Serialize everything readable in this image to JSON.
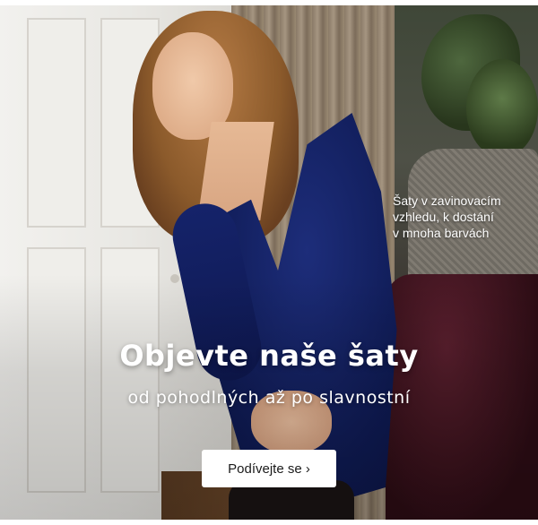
{
  "banner": {
    "caption_lines": [
      "Šaty v zavinovacím",
      "vzhledu, k dostání",
      "v mnoha barvách"
    ],
    "headline": "Objevte naše šaty",
    "subline": "od pohodlných až po slavnostní",
    "cta_label": "Podívejte se ›"
  },
  "colors": {
    "dress": "#0f1b55",
    "cta_background": "#ffffff",
    "text": "#ffffff"
  }
}
